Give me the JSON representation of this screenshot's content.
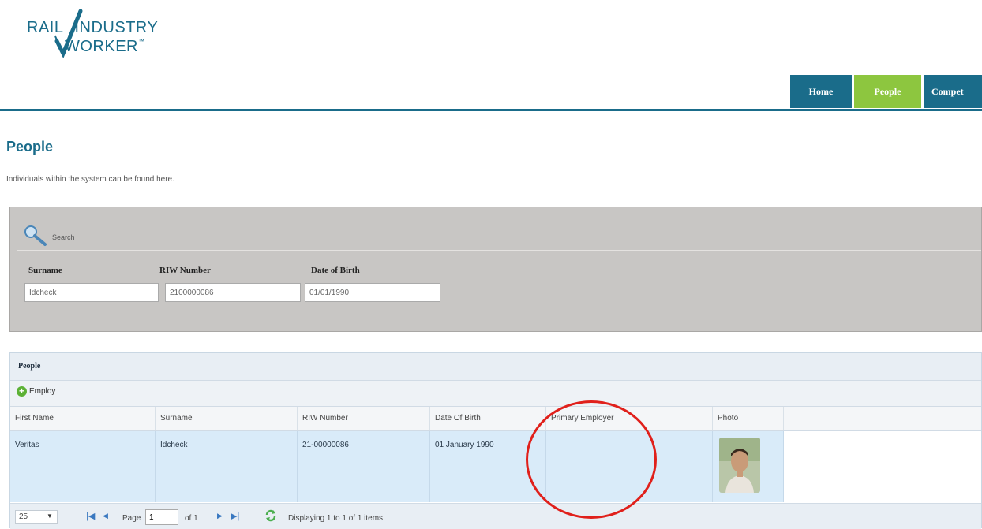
{
  "logo": {
    "line1": "RAIL",
    "line1b": "INDUSTRY",
    "line2": "WORKER",
    "tm": "™"
  },
  "nav": {
    "tabs": [
      {
        "label": "Home"
      },
      {
        "label": "People"
      },
      {
        "label": "Compet"
      }
    ]
  },
  "page": {
    "title": "People",
    "description": "Individuals within the system can be found here."
  },
  "search": {
    "label": "Search",
    "fields": [
      {
        "label": "Surname",
        "value": "Idcheck"
      },
      {
        "label": "RIW Number",
        "value": "2100000086"
      },
      {
        "label": "Date of Birth",
        "value": "01/01/1990"
      }
    ]
  },
  "grid": {
    "title": "People",
    "employ_label": "Employ",
    "columns": [
      "First Name",
      "Surname",
      "RIW Number",
      "Date Of Birth",
      "Primary Employer",
      "Photo"
    ],
    "rows": [
      {
        "first_name": "Veritas",
        "surname": "Idcheck",
        "riw": "21-00000086",
        "dob": "01 January 1990",
        "employer": ""
      }
    ]
  },
  "pager": {
    "page_size": "25",
    "page_label": "Page",
    "page_value": "1",
    "of_label": "of 1",
    "display_text": "Displaying 1 to 1 of 1 items"
  },
  "colors": {
    "brand": "#1a6c8a",
    "active_tab": "#8dc63f",
    "annotation": "#e0201b"
  }
}
